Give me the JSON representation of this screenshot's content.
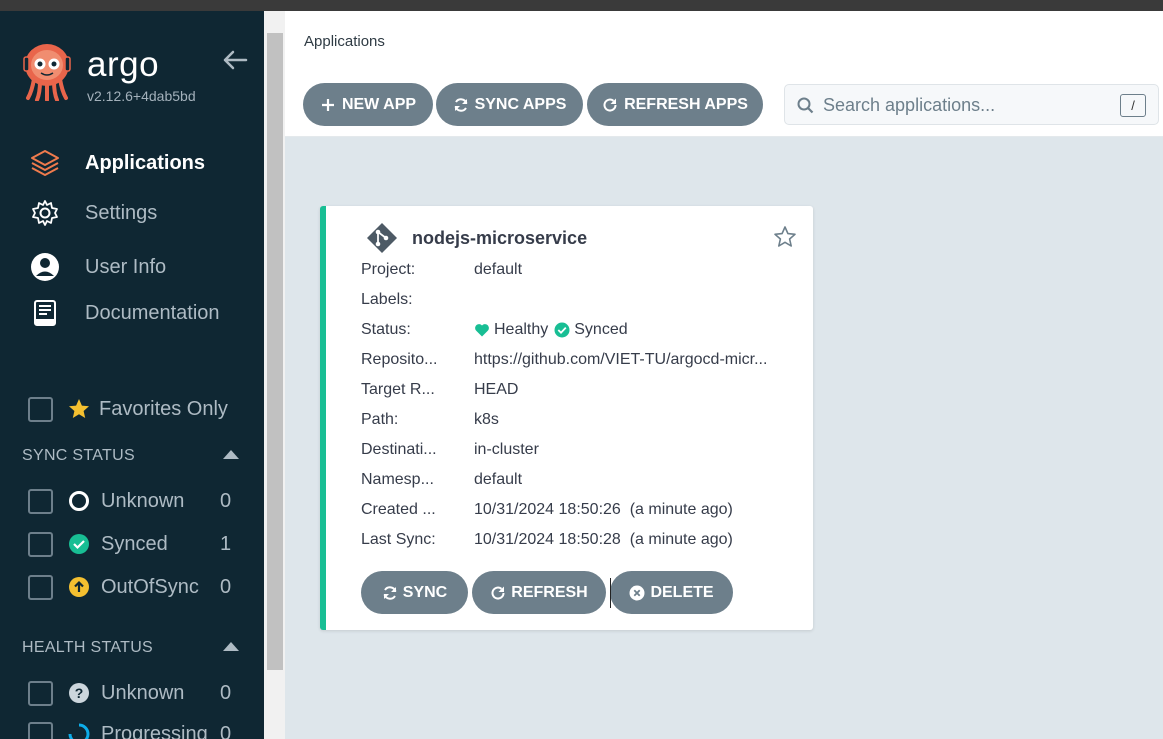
{
  "app": {
    "brand": "argo",
    "version": "v2.12.6+4dab5bd"
  },
  "sidebar": {
    "nav": [
      {
        "label": "Applications",
        "icon": "layers-icon",
        "active": true
      },
      {
        "label": "Settings",
        "icon": "gear-icon",
        "active": false
      },
      {
        "label": "User Info",
        "icon": "user-circle-icon",
        "active": false
      },
      {
        "label": "Documentation",
        "icon": "book-icon",
        "active": false
      }
    ],
    "favorites_label": "Favorites Only",
    "sync_status": {
      "header": "SYNC STATUS",
      "items": [
        {
          "label": "Unknown",
          "count": "0",
          "icon": "unknown-ring-icon"
        },
        {
          "label": "Synced",
          "count": "1",
          "icon": "check-circle-icon"
        },
        {
          "label": "OutOfSync",
          "count": "0",
          "icon": "arrow-up-circle-icon"
        }
      ]
    },
    "health_status": {
      "header": "HEALTH STATUS",
      "items": [
        {
          "label": "Unknown",
          "count": "0",
          "icon": "question-circle-icon"
        },
        {
          "label": "Progressing",
          "count": "0",
          "icon": "spinner-icon"
        }
      ]
    }
  },
  "header": {
    "title": "Applications"
  },
  "toolbar": {
    "new_app": "NEW APP",
    "sync_apps": "SYNC APPS",
    "refresh_apps": "REFRESH APPS",
    "search_placeholder": "Search applications...",
    "search_shortcut": "/"
  },
  "card": {
    "name": "nodejs-microservice",
    "rows": [
      {
        "label": "Project:",
        "value": "default"
      },
      {
        "label": "Labels:",
        "value": ""
      },
      {
        "label": "Status:",
        "health": "Healthy",
        "sync": "Synced"
      },
      {
        "label": "Reposito...",
        "value": "https://github.com/VIET-TU/argocd-micr..."
      },
      {
        "label": "Target R...",
        "value": "HEAD"
      },
      {
        "label": "Path:",
        "value": "k8s"
      },
      {
        "label": "Destinati...",
        "value": "in-cluster"
      },
      {
        "label": "Namesp...",
        "value": "default"
      },
      {
        "label": "Created ...",
        "value": "10/31/2024 18:50:26  (a minute ago)"
      },
      {
        "label": "Last Sync:",
        "value": "10/31/2024 18:50:28  (a minute ago)"
      }
    ],
    "actions": {
      "sync": "SYNC",
      "refresh": "REFRESH",
      "delete": "DELETE"
    }
  },
  "colors": {
    "sidebar_bg": "#0f2733",
    "accent_healthy": "#18be94",
    "button_bg": "#6d7f8b",
    "argo_orange": "#ef7b4d",
    "outofsync_yellow": "#f4c030",
    "progressing_blue": "#0dadea"
  }
}
